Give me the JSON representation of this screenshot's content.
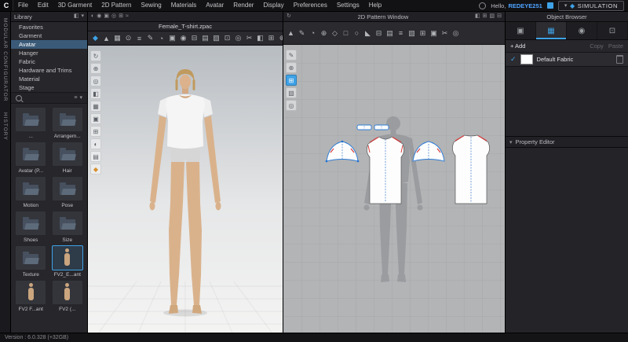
{
  "menubar": {
    "logo": "C",
    "items": [
      "File",
      "Edit",
      "3D Garment",
      "2D Pattern",
      "Sewing",
      "Materials",
      "Avatar",
      "Render",
      "Display",
      "Preferences",
      "Settings",
      "Help"
    ],
    "hello_prefix": "Hello,",
    "username": "REDEYE251",
    "simulation_label": "SIMULATION",
    "sim_icons": {
      "chevron": "▾",
      "cube": "◆"
    }
  },
  "rail": {
    "tabs": [
      "MODULAR CONFIGURATOR",
      "HISTORY"
    ]
  },
  "library": {
    "title": "Library",
    "header_icons": [
      {
        "name": "pin-icon",
        "glyph": "◧"
      },
      {
        "name": "collapse-panel-icon",
        "glyph": "▾"
      }
    ],
    "categories": [
      {
        "label": "Favorites"
      },
      {
        "label": "Garment"
      },
      {
        "label": "Avatar",
        "selected": true
      },
      {
        "label": "Hanger"
      },
      {
        "label": "Fabric"
      },
      {
        "label": "Hardware and Trims"
      },
      {
        "label": "Material"
      },
      {
        "label": "Stage"
      }
    ],
    "view_icons": [
      {
        "name": "list-view-icon",
        "glyph": "≡"
      },
      {
        "name": "sort-icon",
        "glyph": "▾"
      }
    ],
    "items": [
      {
        "label": "...",
        "kind": "folder"
      },
      {
        "label": "Arrangem...",
        "kind": "folder"
      },
      {
        "label": "Avatar (P...",
        "kind": "folder"
      },
      {
        "label": "Hair",
        "kind": "folder"
      },
      {
        "label": "Motion",
        "kind": "folder"
      },
      {
        "label": "Pose",
        "kind": "folder"
      },
      {
        "label": "Shoes",
        "kind": "folder"
      },
      {
        "label": "Size",
        "kind": "folder"
      },
      {
        "label": "Texture",
        "kind": "folder"
      },
      {
        "label": "FV2_E...ant",
        "kind": "avatar",
        "selected": true
      },
      {
        "label": "FV2 F...ant",
        "kind": "avatar"
      },
      {
        "label": "FV2 (...",
        "kind": "avatar"
      }
    ]
  },
  "viewport3d": {
    "filename": "Female_T-shirt.zpac",
    "header_icons": [
      {
        "name": "render-style-icon",
        "glyph": "◐"
      },
      {
        "name": "show-avatar-icon",
        "glyph": "◉"
      },
      {
        "name": "camera-view-icon",
        "glyph": "▣"
      },
      {
        "name": "light-icon",
        "glyph": "◎"
      },
      {
        "name": "show-grid-icon",
        "glyph": "⊞"
      },
      {
        "name": "wind-icon",
        "glyph": "≈"
      }
    ],
    "toolbar": [
      {
        "name": "simulate-icon",
        "glyph": "◆",
        "accent": true
      },
      {
        "name": "select-move-icon",
        "glyph": "▲"
      },
      {
        "name": "select-mesh-icon",
        "glyph": "▦"
      },
      {
        "name": "pin-icon",
        "glyph": "⊙"
      },
      {
        "name": "segment-sewing-icon",
        "glyph": "≡"
      },
      {
        "name": "free-sewing-icon",
        "glyph": "✎"
      },
      {
        "name": "steam-brush-icon",
        "glyph": "◔"
      },
      {
        "name": "solidify-icon",
        "glyph": "▣"
      },
      {
        "name": "button-icon",
        "glyph": "◉"
      },
      {
        "name": "buttonhole-icon",
        "glyph": "⊟"
      },
      {
        "name": "topstitch-icon",
        "glyph": "▤"
      },
      {
        "name": "fabric-texture-icon",
        "glyph": "▧"
      },
      {
        "name": "zipper-icon",
        "glyph": "⊡"
      },
      {
        "name": "measure-tape-icon",
        "glyph": "◎"
      },
      {
        "name": "scissors-icon",
        "glyph": "✂"
      },
      {
        "name": "avatar-display-icon",
        "glyph": "◧"
      },
      {
        "name": "flatten-icon",
        "glyph": "⊞"
      },
      {
        "name": "arrangement-icon",
        "glyph": "⊕"
      }
    ],
    "side_tools": [
      {
        "name": "reset-view-icon",
        "glyph": "↻"
      },
      {
        "name": "zoom-fit-icon",
        "glyph": "⊕"
      },
      {
        "name": "focus-icon",
        "glyph": "◎"
      },
      {
        "name": "show-avatar-icon",
        "glyph": "◧"
      },
      {
        "name": "show-mesh-icon",
        "glyph": "▦"
      },
      {
        "name": "render-style-icon",
        "glyph": "▣"
      },
      {
        "name": "show-grid-icon",
        "glyph": "⊞"
      },
      {
        "name": "shade-mode-icon",
        "glyph": "◐"
      },
      {
        "name": "show-stitch-icon",
        "glyph": "▤"
      },
      {
        "name": "colorway-icon",
        "glyph": "◆",
        "warn": true
      }
    ]
  },
  "viewport2d": {
    "title": "2D Pattern Window",
    "header_left_icons": [
      {
        "name": "sync-icon",
        "glyph": "↻"
      }
    ],
    "header_right_icons": [
      {
        "name": "show-pattern-icon",
        "glyph": "◧"
      },
      {
        "name": "show-grid-icon",
        "glyph": "⊞"
      },
      {
        "name": "show-texture-icon",
        "glyph": "▧"
      },
      {
        "name": "layout-icon",
        "glyph": "⊟"
      }
    ],
    "toolbar": [
      {
        "name": "transform-pattern-icon",
        "glyph": "▲"
      },
      {
        "name": "edit-pattern-icon",
        "glyph": "✎"
      },
      {
        "name": "edit-curvature-icon",
        "glyph": "◔"
      },
      {
        "name": "add-point-icon",
        "glyph": "⊕"
      },
      {
        "name": "polygon-tool-icon",
        "glyph": "◇"
      },
      {
        "name": "rectangle-tool-icon",
        "glyph": "□"
      },
      {
        "name": "circle-tool-icon",
        "glyph": "○"
      },
      {
        "name": "dart-tool-icon",
        "glyph": "◣"
      },
      {
        "name": "notch-icon",
        "glyph": "⊟"
      },
      {
        "name": "seam-allowance-icon",
        "glyph": "▤"
      },
      {
        "name": "tack-icon",
        "glyph": "≡"
      },
      {
        "name": "grading-icon",
        "glyph": "▧"
      },
      {
        "name": "print-layout-icon",
        "glyph": "⊞"
      },
      {
        "name": "texture-editor-icon",
        "glyph": "▣"
      },
      {
        "name": "scissors-icon",
        "glyph": "✂"
      },
      {
        "name": "measure-icon",
        "glyph": "◎"
      }
    ],
    "side_tools": [
      {
        "name": "edit-pattern-icon",
        "glyph": "✎"
      },
      {
        "name": "add-point-icon",
        "glyph": "⊕"
      },
      {
        "name": "show-grid-icon",
        "glyph": "⊞",
        "active": true
      },
      {
        "name": "show-texture-icon",
        "glyph": "▧"
      },
      {
        "name": "measure-icon",
        "glyph": "◎"
      }
    ]
  },
  "object_browser": {
    "title": "Object Browser",
    "tabs": [
      {
        "name": "tab-scene",
        "glyph": "▣"
      },
      {
        "name": "tab-fabric",
        "glyph": "▦",
        "active": true
      },
      {
        "name": "tab-button",
        "glyph": "◉"
      },
      {
        "name": "tab-trim",
        "glyph": "⊡"
      }
    ],
    "add_label": "+ Add",
    "copy_label": "Copy",
    "paste_label": "Paste",
    "check_glyph": "✓",
    "fabrics": [
      {
        "label": "Default Fabric",
        "selected": true
      }
    ]
  },
  "property_editor": {
    "title": "Property Editor",
    "caret_glyph": "▾"
  },
  "statusbar": {
    "version": "Version : 6.0.328 (+32GB)"
  }
}
